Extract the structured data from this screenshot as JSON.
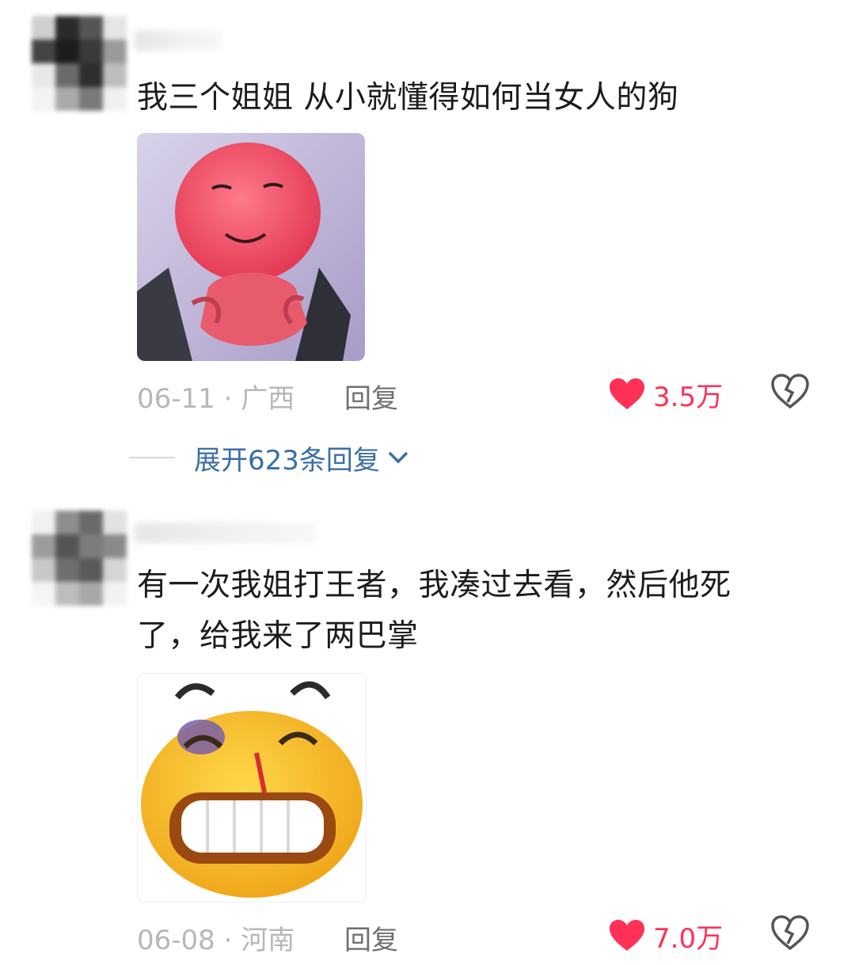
{
  "comments": [
    {
      "text": "我三个姐姐 从小就懂得如何当女人的狗",
      "date_location": "06-11 · 广西",
      "reply_label": "回复",
      "like_count": "3.5万",
      "expand_label": "展开623条回复"
    },
    {
      "text": "有一次我姐打王者，我凑过去看，然后他死\n了，给我来了两巴掌",
      "date_location": "06-08 · 河南",
      "reply_label": "回复",
      "like_count": "7.0万"
    }
  ],
  "colors": {
    "like": "#ff3156",
    "expand_link": "#3a6ea5",
    "meta_text": "#b7b7b7"
  },
  "icons": [
    "heart-icon",
    "broken-heart-icon",
    "chevron-down-icon"
  ]
}
